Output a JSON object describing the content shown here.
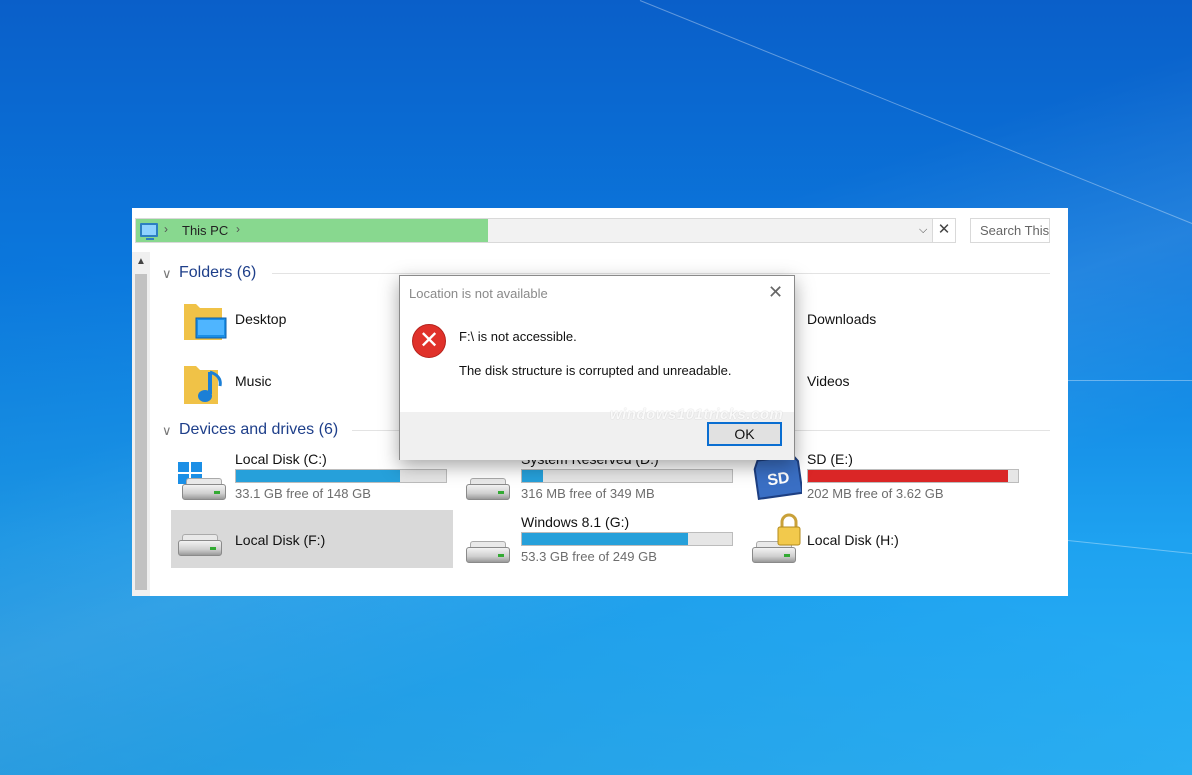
{
  "address_bar": {
    "location": "This PC",
    "search_placeholder": "Search This",
    "close_glyph": "✕",
    "dropdown_glyph": "⌵",
    "separator_glyph": "›"
  },
  "folders_group": {
    "header": "Folders (6)",
    "items": [
      {
        "label": "Desktop",
        "icon": "desktop-folder-icon"
      },
      {
        "label": "Downloads",
        "icon": "downloads-folder-icon"
      },
      {
        "label": "Music",
        "icon": "music-folder-icon"
      },
      {
        "label": "Videos",
        "icon": "videos-folder-icon"
      }
    ]
  },
  "drives_group": {
    "header": "Devices and drives (6)",
    "drives": [
      {
        "label": "Local Disk (C:)",
        "free": "33.1 GB free of 148 GB",
        "used_fraction": 0.78,
        "bar_color": "#26a0da",
        "icon": "windows-drive-icon"
      },
      {
        "label": "System Reserved (D:)",
        "free": "316 MB free of 349 MB",
        "used_fraction": 0.1,
        "bar_color": "#26a0da",
        "icon": "drive-icon"
      },
      {
        "label": "SD (E:)",
        "free": "202 MB free of 3.62 GB",
        "used_fraction": 0.95,
        "bar_color": "#da2626",
        "icon": "sd-card-icon"
      },
      {
        "label": "Local Disk (F:)",
        "icon": "drive-icon"
      },
      {
        "label": "Windows 8.1 (G:)",
        "free": "53.3 GB free of 249 GB",
        "used_fraction": 0.79,
        "bar_color": "#26a0da",
        "icon": "drive-icon"
      },
      {
        "label": "Local Disk (H:)",
        "icon": "locked-drive-icon"
      }
    ]
  },
  "dialog": {
    "title": "Location is not available",
    "close_glyph": "✕",
    "error_glyph": "✕",
    "message1": "F:\\ is not accessible.",
    "message2": "The disk structure is corrupted and unreadable.",
    "ok_label": "OK",
    "watermark": "windows101tricks.com"
  },
  "colors": {
    "progress_green": "#88d88f",
    "accent_blue": "#26a0da",
    "error_red": "#e0312a"
  }
}
